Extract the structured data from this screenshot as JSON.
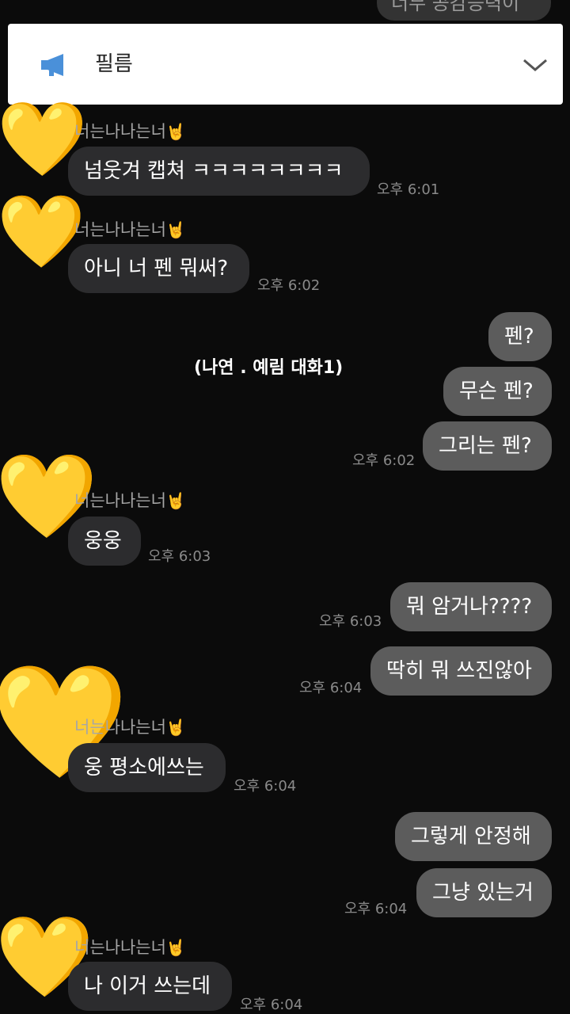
{
  "header": {
    "partial_text": "너무 공감능력이",
    "partial_left": "<",
    "partial_right": "Q  ☰"
  },
  "notice": {
    "icon": "megaphone-icon",
    "label": "필름",
    "expand_icon": "chevron-down-icon"
  },
  "caption": "(나연 . 예림 대화1)",
  "chat": {
    "sender_name": "너는나나는너",
    "sender_suffix": "🤘",
    "avatar_emoji": "💛",
    "m1": {
      "text": "넘웃겨 캡쳐 ㅋㅋㅋㅋㅋㅋㅋㅋ",
      "time": "오후 6:01"
    },
    "m2": {
      "text": "아니 너 펜 뭐써?",
      "time": "오후 6:02"
    },
    "m3": {
      "text": "펜?"
    },
    "m4": {
      "text": "무슨 펜?"
    },
    "m5": {
      "text": "그리는 펜?",
      "time": "오후 6:02"
    },
    "m6": {
      "text": "웅웅",
      "time": "오후 6:03"
    },
    "m7": {
      "text": "뭐 암거나????",
      "time": "오후 6:03"
    },
    "m8": {
      "text": "딱히 뭐 쓰진않아",
      "time": "오후 6:04"
    },
    "m9": {
      "text": "웅 평소에쓰는",
      "time": "오후 6:04"
    },
    "m10": {
      "text": "그렇게 안정해"
    },
    "m11": {
      "text": "그냥 있는거",
      "time": "오후 6:04"
    },
    "m12": {
      "text": "나 이거 쓰는데",
      "time": "오후 6:04"
    }
  },
  "colors": {
    "background": "#0b0b0b",
    "incoming_bubble": "#2c2c2e",
    "outgoing_bubble": "#5c5c5c",
    "notice_icon": "#4a90d9"
  }
}
